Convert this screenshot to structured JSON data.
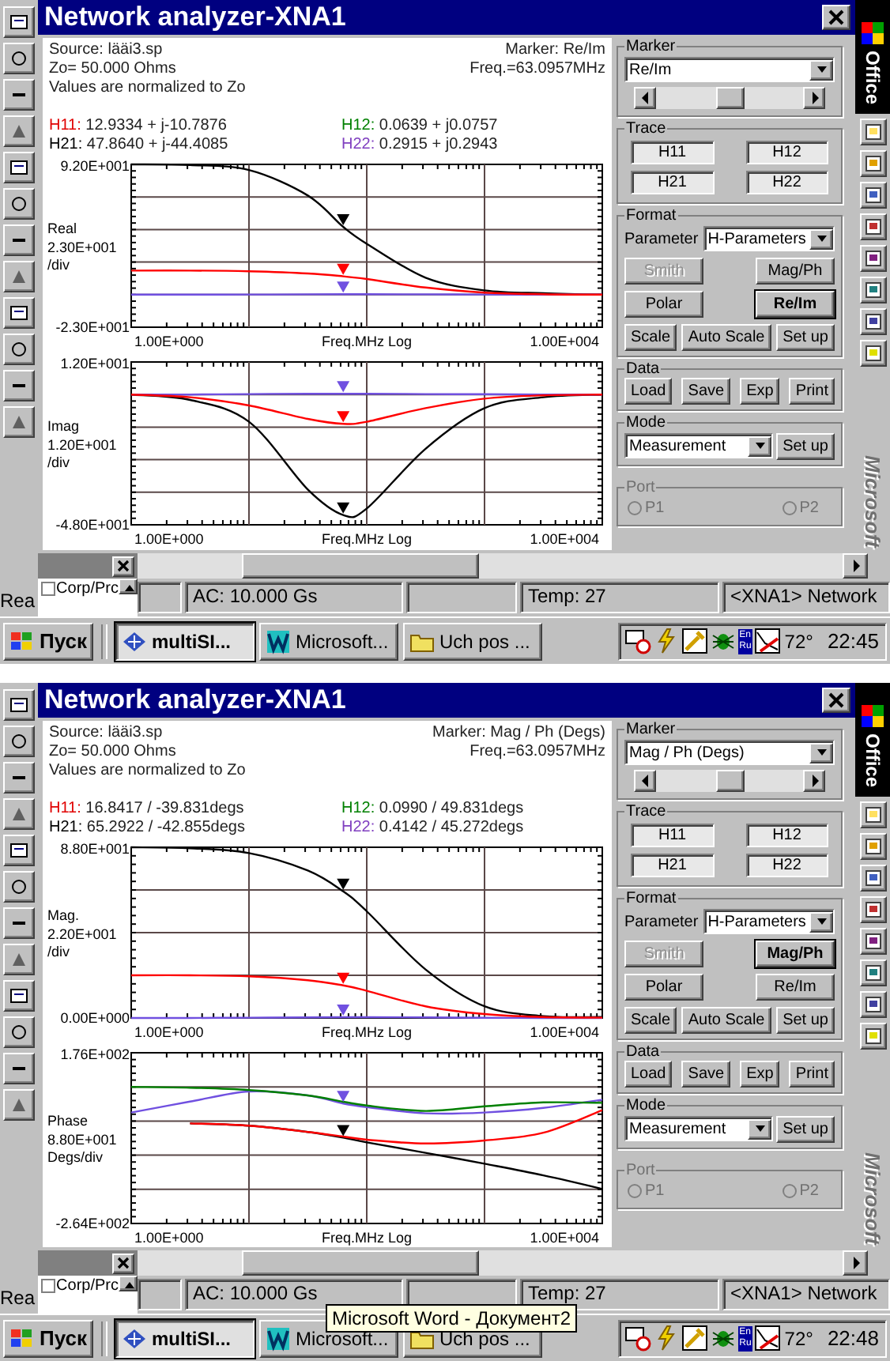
{
  "screens": [
    {
      "window": {
        "title": "Network analyzer-XNA1"
      },
      "info": {
        "source": "Source: lääi3.sp",
        "marker": "Marker: Re/Im",
        "impedance": "Zo= 50.000  Ohms",
        "frequency": "Freq.=63.0957MHz",
        "note": "Values are normalized to Zo",
        "readings": [
          {
            "label": "H11:",
            "value": "12.9334 + j-10.7876",
            "color": "#e00000"
          },
          {
            "label": "H12:",
            "value": "0.0639 + j0.0757",
            "color": "#008000"
          },
          {
            "label": "H21:",
            "value": "47.8640 + j-44.4085",
            "color": "#000000"
          },
          {
            "label": "H22:",
            "value": "0.2915 + j0.2943",
            "color": "#8040c0"
          }
        ]
      },
      "plots": [
        {
          "kind": "real",
          "y_top": "9.20E+001",
          "y_bottom": "-2.30E+001",
          "ylabel": "Real",
          "scale": "2.30E+001",
          "unit": "/div",
          "x_start": "1.00E+000",
          "xlabel": "Freq.MHz Log",
          "x_end": "1.00E+004"
        },
        {
          "kind": "imag",
          "y_top": "1.20E+001",
          "y_bottom": "-4.80E+001",
          "ylabel": "Imag",
          "scale": "1.20E+001",
          "unit": "/div",
          "x_start": "1.00E+000",
          "xlabel": "Freq.MHz Log",
          "x_end": "1.00E+004"
        }
      ],
      "controls": {
        "marker": {
          "label": "Marker",
          "select": "Re/Im",
          "slider": {
            "level": 0.5
          }
        },
        "trace": {
          "label": "Trace",
          "buttons": [
            "H11",
            "H12",
            "H21",
            "H22"
          ]
        },
        "format": {
          "label": "Format",
          "parameter_label": "Parameter",
          "parameter": "H-Parameters",
          "buttons": [
            {
              "label": "Smith",
              "disabled": true,
              "selected": false
            },
            {
              "label": "Mag/Ph",
              "disabled": false,
              "selected": false
            },
            {
              "label": "Polar",
              "disabled": false,
              "selected": false
            },
            {
              "label": "Re/Im",
              "disabled": false,
              "selected": true
            }
          ],
          "actions": [
            "Scale",
            "Auto Scale",
            "Set up"
          ]
        },
        "data": {
          "label": "Data",
          "buttons": [
            "Load",
            "Save",
            "Exp",
            "Print"
          ]
        },
        "mode": {
          "label": "Mode",
          "select": "Measurement",
          "button": "Set up"
        },
        "port": {
          "label": "Port",
          "options": [
            {
              "label": "P1",
              "selected": false,
              "disabled": true
            },
            {
              "label": "P2",
              "selected": false,
              "disabled": true
            }
          ]
        }
      },
      "office": {
        "title": "Office",
        "brand": "Microsoft"
      },
      "side_panel": {
        "items": [
          {
            "label": "Corp/Prc",
            "checked": false
          }
        ]
      },
      "status_left": "Rea",
      "status": [
        "AC: 10.000 Gs",
        "Temp: 27",
        "<XNA1> Network"
      ],
      "taskbar": {
        "start": "Пуск",
        "tasks": [
          {
            "label": "multiSI...",
            "selected": true
          },
          {
            "label": "Microsoft...",
            "selected": false
          },
          {
            "label": "Uch pos ...",
            "selected": false
          }
        ],
        "layout": [
          "En",
          "Ru"
        ],
        "temperature": "72°",
        "clock": "22:45"
      }
    },
    {
      "window": {
        "title": "Network analyzer-XNA1"
      },
      "info": {
        "source": "Source: lääi3.sp",
        "marker": "Marker: Mag / Ph (Degs)",
        "impedance": "Zo= 50.000  Ohms",
        "frequency": "Freq.=63.0957MHz",
        "note": "Values are normalized to Zo",
        "readings": [
          {
            "label": "H11:",
            "value": "16.8417 / -39.831degs",
            "color": "#e00000"
          },
          {
            "label": "H12:",
            "value": "0.0990 / 49.831degs",
            "color": "#008000"
          },
          {
            "label": "H21:",
            "value": "65.2922 / -42.855degs",
            "color": "#000000"
          },
          {
            "label": "H22:",
            "value": "0.4142 / 45.272degs",
            "color": "#8040c0"
          }
        ]
      },
      "plots": [
        {
          "kind": "mag",
          "y_top": "8.80E+001",
          "y_bottom": "0.00E+000",
          "ylabel": "Mag.",
          "scale": "2.20E+001",
          "unit": "/div",
          "x_start": "1.00E+000",
          "xlabel": "Freq.MHz Log",
          "x_end": "1.00E+004"
        },
        {
          "kind": "phase",
          "y_top": "1.76E+002",
          "y_bottom": "-2.64E+002",
          "ylabel": "Phase",
          "scale": "8.80E+001",
          "unit": "Degs/div",
          "x_start": "1.00E+000",
          "xlabel": "Freq.MHz Log",
          "x_end": "1.00E+004"
        }
      ],
      "controls": {
        "marker": {
          "label": "Marker",
          "select": "Mag / Ph (Degs)",
          "slider": {
            "level": 0.5
          }
        },
        "trace": {
          "label": "Trace",
          "buttons": [
            "H11",
            "H12",
            "H21",
            "H22"
          ]
        },
        "format": {
          "label": "Format",
          "parameter_label": "Parameter",
          "parameter": "H-Parameters",
          "buttons": [
            {
              "label": "Smith",
              "disabled": true,
              "selected": false
            },
            {
              "label": "Mag/Ph",
              "disabled": false,
              "selected": true
            },
            {
              "label": "Polar",
              "disabled": false,
              "selected": false
            },
            {
              "label": "Re/Im",
              "disabled": false,
              "selected": false
            }
          ],
          "actions": [
            "Scale",
            "Auto Scale",
            "Set up"
          ]
        },
        "data": {
          "label": "Data",
          "buttons": [
            "Load",
            "Save",
            "Exp",
            "Print"
          ]
        },
        "mode": {
          "label": "Mode",
          "select": "Measurement",
          "button": "Set up"
        },
        "port": {
          "label": "Port",
          "options": [
            {
              "label": "P1",
              "selected": false,
              "disabled": true
            },
            {
              "label": "P2",
              "selected": false,
              "disabled": true
            }
          ]
        }
      },
      "office": {
        "title": "Office",
        "brand": "Microsoft"
      },
      "side_panel": {
        "items": [
          {
            "label": "Corp/Prc",
            "checked": false
          }
        ]
      },
      "status_left": "Rea",
      "status": [
        "AC: 10.000 Gs",
        "Temp: 27",
        "<XNA1> Network"
      ],
      "taskbar": {
        "start": "Пуск",
        "tasks": [
          {
            "label": "multiSI...",
            "selected": true
          },
          {
            "label": "Microsoft...",
            "selected": false
          },
          {
            "label": "Uch pos ...",
            "selected": false
          }
        ],
        "layout": [
          "En",
          "Ru"
        ],
        "temperature": "72°",
        "clock": "22:48"
      },
      "tooltip": "Microsoft Word - Документ2"
    }
  ]
}
